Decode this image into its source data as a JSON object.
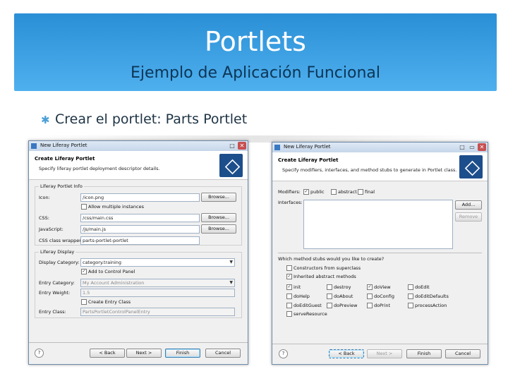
{
  "slide": {
    "title": "Portlets",
    "subtitle": "Ejemplo de Aplicación Funcional",
    "bullet": "Crear el portlet: Parts Portlet"
  },
  "dialog1": {
    "window_title": "New Liferay Portlet",
    "header_title": "Create Liferay Portlet",
    "header_desc": "Specify liferay portlet deployment descriptor details.",
    "portlet_group": "Liferay Portlet Info",
    "icon_label": "Icon:",
    "icon_value": "/icon.png",
    "allow_multiple": "Allow multiple instances",
    "css_label": "CSS:",
    "css_value": "/css/main.css",
    "js_label": "JavaScript:",
    "js_value": "/js/main.js",
    "wrapper_label": "CSS class wrapper:",
    "wrapper_value": "parts-portlet-portlet",
    "browse": "Browse...",
    "entry_group": "Liferay Display",
    "display_category_label": "Display Category:",
    "display_category_value": "category.training",
    "add_control_panel": "Add to Control Panel",
    "entry_category_label": "Entry Category:",
    "entry_category_value": "My Account Administration",
    "entry_weight_label": "Entry Weight:",
    "entry_weight_value": "1.5",
    "create_entry_class": "Create Entry Class",
    "entry_class_label": "Entry Class:",
    "entry_class_value": "PartsPortletControlPanelEntry",
    "back": "< Back",
    "next": "Next >",
    "finish": "Finish",
    "cancel": "Cancel",
    "help": "?"
  },
  "dialog2": {
    "window_title": "New Liferay Portlet",
    "header_title": "Create Liferay Portlet",
    "header_desc": "Specify modifiers, interfaces, and method stubs to generate in Portlet class.",
    "modifiers_label": "Modifiers:",
    "mod_public": "public",
    "mod_abstract": "abstract",
    "mod_final": "final",
    "interfaces_label": "Interfaces:",
    "add": "Add...",
    "remove": "Remove",
    "question": "Which method stubs would you like to create?",
    "constructors": "Constructors from superclass",
    "inherited": "Inherited abstract methods",
    "methods": [
      "init",
      "destroy",
      "doView",
      "doEdit",
      "doHelp",
      "doAbout",
      "doConfig",
      "doEditDefaults",
      "doEditGuest",
      "doPreview",
      "doPrint",
      "processAction",
      "serveResource"
    ],
    "back": "< Back",
    "next": "Next >",
    "finish": "Finish",
    "cancel": "Cancel",
    "help": "?"
  }
}
